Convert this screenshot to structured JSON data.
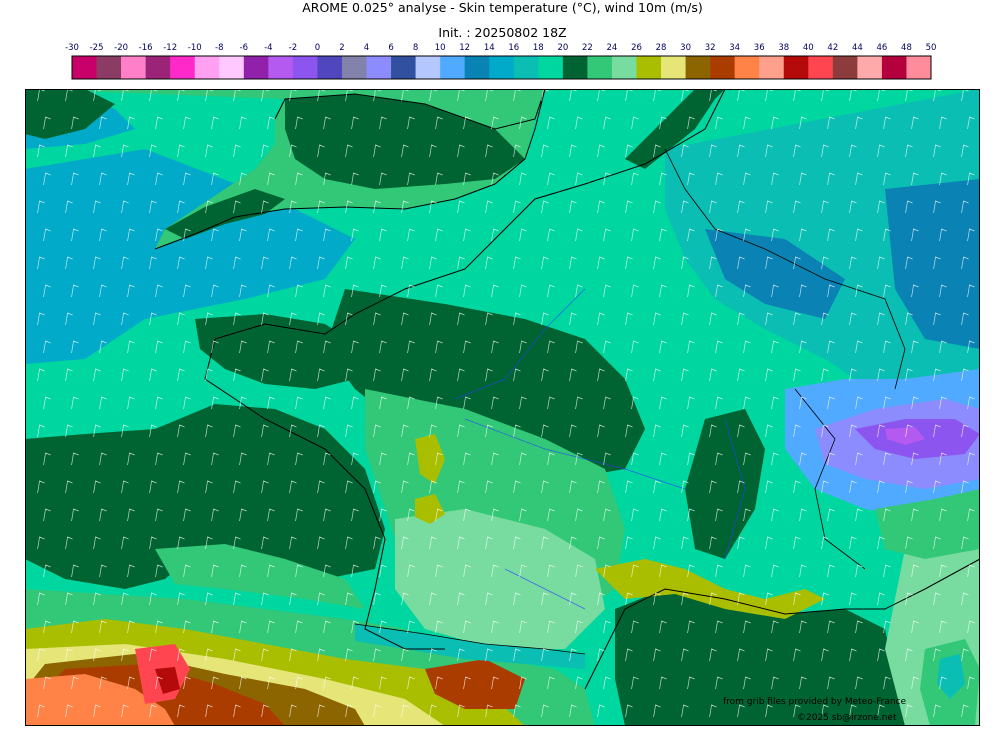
{
  "header": {
    "title": "AROME 0.025° analyse - Skin temperature (°C), wind 10m (m/s)",
    "init": "Init. : 20250802 18Z"
  },
  "legend": {
    "labels": [
      "-30",
      "-25",
      "-20",
      "-16",
      "-12",
      "-10",
      "-8",
      "-6",
      "-4",
      "-2",
      "0",
      "2",
      "4",
      "6",
      "8",
      "10",
      "12",
      "14",
      "16",
      "18",
      "20",
      "22",
      "24",
      "26",
      "28",
      "30",
      "32",
      "34",
      "36",
      "38",
      "40",
      "42",
      "44",
      "46",
      "48",
      "50"
    ],
    "colors": [
      "#c80069",
      "#8c3c64",
      "#ff80c8",
      "#9b2378",
      "#ff28c8",
      "#ffa0f0",
      "#ffc8ff",
      "#9120aa",
      "#b45af0",
      "#8c55f0",
      "#5046be",
      "#8282aa",
      "#8c8cff",
      "#3250a0",
      "#b4c8ff",
      "#50aaff",
      "#0a82b4",
      "#00aac8",
      "#0abeb4",
      "#00d7a0",
      "#006432",
      "#32c878",
      "#78dca0",
      "#aabe00",
      "#e6e678",
      "#8c6400",
      "#aa3c00",
      "#ff8246",
      "#ffa08c",
      "#b40a0a",
      "#ff4650",
      "#8c3c3c",
      "#ffaaaa",
      "#b4003c",
      "#ff8c9b"
    ]
  },
  "map": {
    "palette": {
      "sea": "#00d7a0",
      "sea_cool": "#00aac8",
      "deep_green": "#006432",
      "light_green": "#32c878",
      "pale_green": "#78dca0",
      "blue_mid": "#0abeb4",
      "blue_dark": "#0a82b4",
      "blue_light": "#50aaff",
      "olive": "#aabe00",
      "yellow": "#e6e678",
      "brown": "#8c6400",
      "rust": "#aa3c00",
      "orange": "#ff8246",
      "red": "#ff4650",
      "dark_red": "#b40a0a",
      "purple": "#8c55f0",
      "violet": "#b45af0",
      "slate": "#5046be",
      "lavender": "#8c8cff"
    }
  },
  "credits": {
    "source": "from grib files provided by Meteo-France",
    "copyright": "©2025 sb@irzone.net"
  }
}
